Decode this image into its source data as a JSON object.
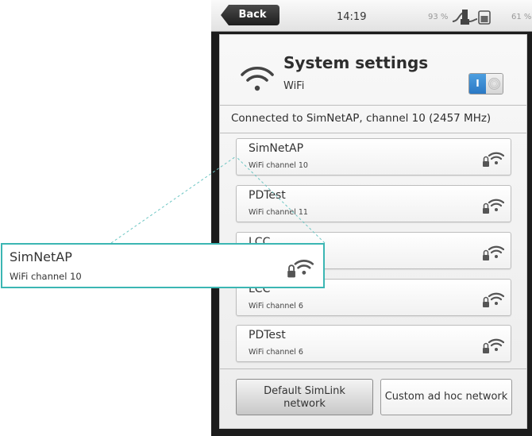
{
  "status_bar": {
    "back_label": "Back",
    "time": "14:19",
    "battery_left": "93 %",
    "battery_right": "61 %"
  },
  "header": {
    "title": "System settings",
    "subtitle": "WiFi",
    "toggle_label": "I",
    "toggle_state": "on",
    "toggle_color": "#3b8fd6"
  },
  "connection_status": "Connected to SimNetAP, channel 10 (2457 MHz)",
  "networks": [
    {
      "name": "SimNetAP",
      "channel": "WiFi channel 10"
    },
    {
      "name": "PDTest",
      "channel": "WiFi channel 11"
    },
    {
      "name": "LCC",
      "channel": ""
    },
    {
      "name": "LCC",
      "channel": "WiFi channel 6"
    },
    {
      "name": "PDTest",
      "channel": "WiFi channel 6"
    }
  ],
  "buttons": {
    "default_network_line1": "Default SimLink",
    "default_network_line2": "network",
    "custom_network": "Custom ad hoc network"
  },
  "zoom": {
    "name": "SimNetAP",
    "channel": "WiFi channel 10",
    "border_color": "#3bb6b3"
  },
  "icons": {
    "header": "wifi-icon",
    "network": "locked-wifi-signal-icon",
    "status_usb": "usb-plug-icon",
    "status_battery": "battery-icon"
  }
}
